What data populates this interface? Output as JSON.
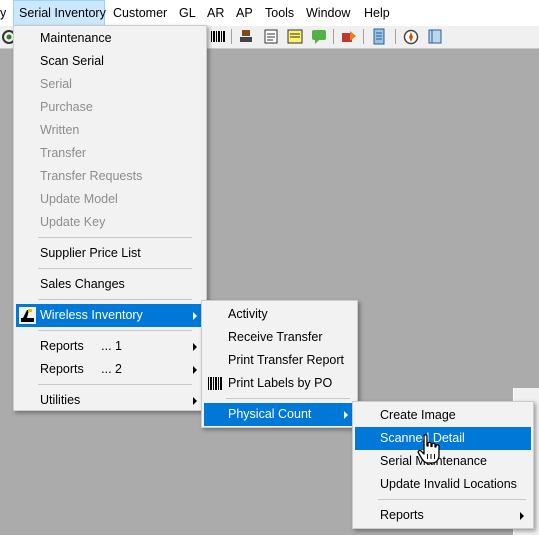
{
  "menubar": {
    "items": [
      {
        "label": "y"
      },
      {
        "label": "Serial Inventory"
      },
      {
        "label": "Customer"
      },
      {
        "label": "GL"
      },
      {
        "label": "AR"
      },
      {
        "label": "AP"
      },
      {
        "label": "Tools"
      },
      {
        "label": "Window"
      },
      {
        "label": "Help"
      }
    ]
  },
  "serial_menu": {
    "items": [
      {
        "label": "Maintenance"
      },
      {
        "label": "Scan Serial"
      },
      {
        "label": "Serial"
      },
      {
        "label": "Purchase"
      },
      {
        "label": "Written"
      },
      {
        "label": "Transfer"
      },
      {
        "label": "Transfer Requests"
      },
      {
        "label": "Update Model"
      },
      {
        "label": "Update Key"
      },
      {
        "label": "Supplier Price List"
      },
      {
        "label": "Sales Changes"
      },
      {
        "label": "Wireless Inventory"
      },
      {
        "label": "Reports     ... 1"
      },
      {
        "label": "Reports     ... 2"
      },
      {
        "label": "Utilities"
      }
    ]
  },
  "wireless_menu": {
    "items": [
      {
        "label": "Activity"
      },
      {
        "label": "Receive Transfer"
      },
      {
        "label": "Print Transfer Report"
      },
      {
        "label": "Print Labels by PO"
      },
      {
        "label": "Physical Count"
      }
    ]
  },
  "physical_menu": {
    "items": [
      {
        "label": "Create Image"
      },
      {
        "label": "Scanned Detail"
      },
      {
        "label": "Serial Maintenance"
      },
      {
        "label": "Update Invalid Locations"
      },
      {
        "label": "Reports"
      }
    ]
  },
  "colors": {
    "highlight": "#0078d7",
    "disabled": "#8d8d8d",
    "menubar_active": "#cce8ff"
  }
}
